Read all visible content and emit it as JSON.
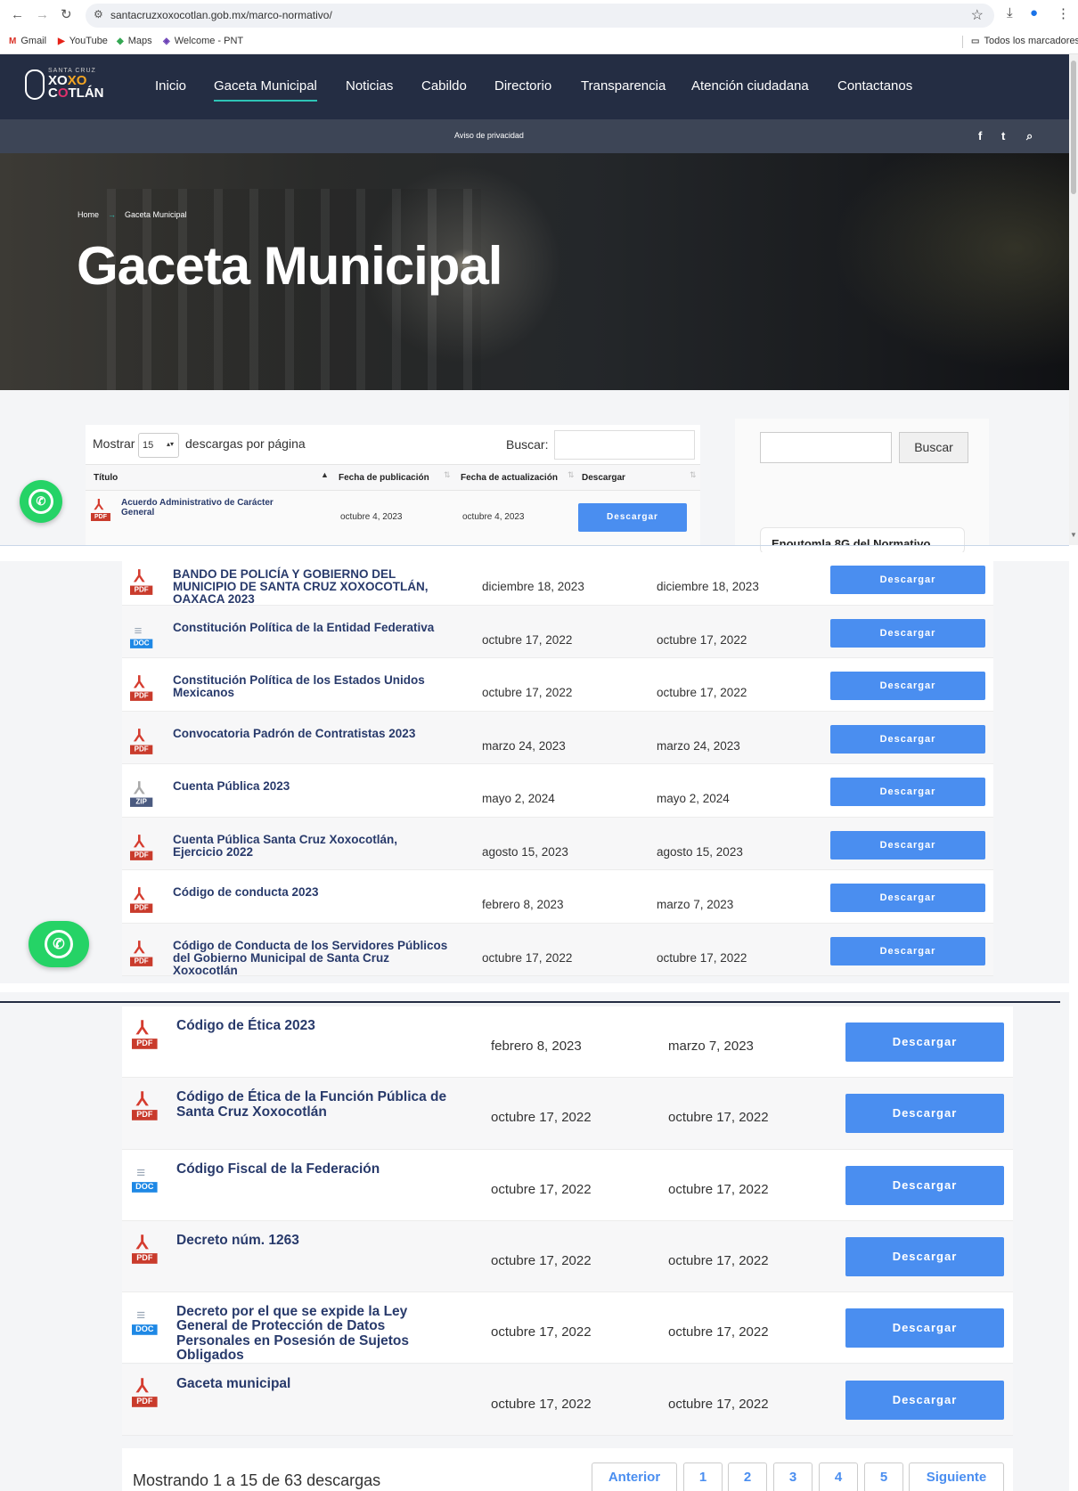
{
  "browser": {
    "url": "santacruzxoxocotlan.gob.mx/marco-normativo/",
    "bookmarks": [
      {
        "label": "Gmail",
        "icon": "M",
        "color": "#d93025"
      },
      {
        "label": "YouTube",
        "icon": "▶",
        "color": "#e62117"
      },
      {
        "label": "Maps",
        "icon": "◆",
        "color": "#34a853"
      },
      {
        "label": "Welcome - PNT",
        "icon": "◈",
        "color": "#6a3fb5"
      }
    ],
    "all_bookmarks": "Todos los marcadores"
  },
  "site": {
    "logo": {
      "top": "SANTA CRUZ",
      "line1a": "XO",
      "line1b": "XO",
      "line2a": "C",
      "line2b": "O",
      "line2c": "TLÁN"
    },
    "menu": [
      "Inicio",
      "Gaceta Municipal",
      "Noticias",
      "Cabildo",
      "Directorio",
      "Transparencia",
      "Atención ciudadana",
      "Contactanos"
    ],
    "active_menu": "Gaceta Municipal",
    "privacy": "Aviso de privacidad",
    "social": [
      "f",
      "t",
      "⌕"
    ]
  },
  "hero": {
    "crumb_home": "Home",
    "crumb_arrow": "→",
    "crumb_current": "Gaceta Municipal",
    "title": "Gaceta Municipal"
  },
  "table": {
    "show_label": "Mostrar",
    "per_page": "15",
    "per_page_suffix": "descargas por página",
    "search_label": "Buscar:",
    "columns": [
      "Título",
      "Fecha de publicación",
      "Fecha de actualización",
      "Descargar"
    ],
    "button_label": "Descargar",
    "first_row": {
      "title": "Acuerdo Administrativo de Carácter General",
      "type": "PDF",
      "published": "octubre 4, 2023",
      "updated": "octubre 4, 2023"
    }
  },
  "sidebar": {
    "search_button": "Buscar",
    "card_title": "Enoutomla 8G del Normativo"
  },
  "rows_a": [
    {
      "title": "BANDO DE POLICÍA Y GOBIERNO DEL MUNICIPIO DE SANTA CRUZ XOXOCOTLÁN, OAXACA 2023",
      "type": "PDF",
      "published": "diciembre 18, 2023",
      "updated": "diciembre 18, 2023"
    },
    {
      "title": "Constitución Política de la Entidad Federativa",
      "type": "DOC",
      "published": "octubre 17, 2022",
      "updated": "octubre 17, 2022"
    },
    {
      "title": "Constitución Política de los Estados Unidos Mexicanos",
      "type": "PDF",
      "published": "octubre 17, 2022",
      "updated": "octubre 17, 2022"
    },
    {
      "title": "Convocatoria Padrón de Contratistas 2023",
      "type": "PDF",
      "published": "marzo 24, 2023",
      "updated": "marzo 24, 2023"
    },
    {
      "title": "Cuenta Pública 2023",
      "type": "ZIP",
      "published": "mayo 2, 2024",
      "updated": "mayo 2, 2024"
    },
    {
      "title": "Cuenta Pública Santa Cruz Xoxocotlán, Ejercicio 2022",
      "type": "PDF",
      "published": "agosto 15, 2023",
      "updated": "agosto 15, 2023"
    },
    {
      "title": "Código de conducta 2023",
      "type": "PDF",
      "published": "febrero 8, 2023",
      "updated": "marzo 7, 2023"
    },
    {
      "title": "Código de Conducta de los Servidores Públicos del Gobierno Municipal de Santa Cruz Xoxocotlán",
      "type": "PDF",
      "published": "octubre 17, 2022",
      "updated": "octubre 17, 2022"
    }
  ],
  "rows_b": [
    {
      "title": "Código de Ética 2023",
      "type": "PDF",
      "published": "febrero 8, 2023",
      "updated": "marzo 7, 2023"
    },
    {
      "title": "Código de Ética de la Función Pública de Santa Cruz Xoxocotlán",
      "type": "PDF",
      "published": "octubre 17, 2022",
      "updated": "octubre 17, 2022"
    },
    {
      "title": "Código Fiscal de la Federación",
      "type": "DOC",
      "published": "octubre 17, 2022",
      "updated": "octubre 17, 2022"
    },
    {
      "title": "Decreto núm. 1263",
      "type": "PDF",
      "published": "octubre 17, 2022",
      "updated": "octubre 17, 2022"
    },
    {
      "title": "Decreto por el que se expide la Ley General de Protección de Datos Personales en Posesión de Sujetos Obligados",
      "type": "DOC",
      "published": "octubre 17, 2022",
      "updated": "octubre 17, 2022"
    },
    {
      "title": "Gaceta municipal",
      "type": "PDF",
      "published": "octubre 17, 2022",
      "updated": "octubre 17, 2022"
    }
  ],
  "footer": {
    "showing": "Mostrando 1 a 15 de 63 descargas",
    "prev": "Anterior",
    "pages": [
      "1",
      "2",
      "3",
      "4",
      "5"
    ],
    "next": "Siguiente"
  }
}
